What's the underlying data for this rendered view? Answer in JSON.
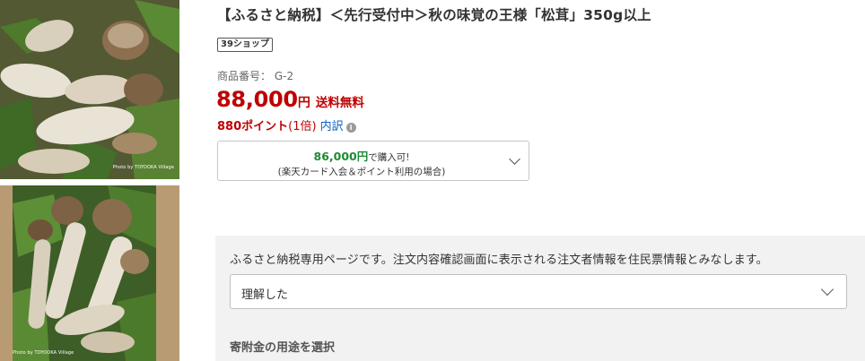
{
  "gallery": {
    "images": [
      {
        "alt": "matsutake-photo-1",
        "credit": "Photo by TOYOOKA Village"
      },
      {
        "alt": "matsutake-photo-2",
        "credit": "Photo by TOYOOKA Village"
      }
    ]
  },
  "product": {
    "title": "【ふるさと納税】＜先行受付中＞秋の味覚の王様「松茸」350g以上",
    "shop_badge": "39ショップ",
    "product_no": "商品番号： G-2",
    "price": "88,000",
    "price_unit": "円",
    "shipping": "送料無料",
    "points": "880ポイント",
    "points_multiplier": "(1倍)",
    "points_breakdown": "内訳",
    "info_icon": "info-icon"
  },
  "card_offer": {
    "price": "86,000円",
    "suffix": "で購入可!",
    "condition": "(楽天カード入会＆ポイント利用の場合)",
    "icon": "chevron-down-icon"
  },
  "notice": {
    "text": "ふるさと納税専用ページです。注文内容確認画面に表示される注文者情報を住民票情報とみなします。",
    "select_value": "理解した",
    "section_label": "寄附金の用途を選択"
  },
  "colors": {
    "price_red": "#bf0000",
    "card_green": "#1e8b33",
    "link_blue": "#0b63c4",
    "panel_gray": "#f2f2f2"
  }
}
